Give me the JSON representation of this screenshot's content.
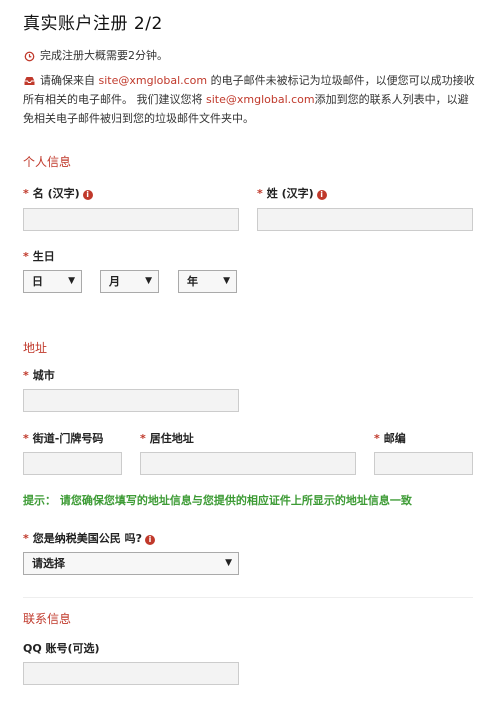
{
  "page": {
    "title": "真实账户注册 2/2"
  },
  "notices": {
    "time_text": "完成注册大概需要2分钟。",
    "email_part1": "请确保来自 ",
    "email_link1": "site@xmglobal.com",
    "email_part2": " 的电子邮件未被标记为垃圾邮件，以便您可以成功接收所有相关的电子邮件。 我们建议您将 ",
    "email_link2": "site@xmglobal.com",
    "email_part3": "添加到您的联系人列表中，以避免相关电子邮件被归到您的垃圾邮件文件夹中。"
  },
  "personal": {
    "section_title": "个人信息",
    "first_name_label": "名 (汉字)",
    "last_name_label": "姓 (汉字)",
    "dob_label": "生日",
    "day": "日",
    "month": "月",
    "year": "年"
  },
  "address": {
    "section_title": "地址",
    "city_label": "城市",
    "street_label": "街道-门牌号码",
    "residence_label": "居住地址",
    "postcode_label": "邮编",
    "hint": "提示：  请您确保您填写的地址信息与您提供的相应证件上所显示的地址信息一致"
  },
  "tax": {
    "us_citizen_label": "您是纳税美国公民 吗?",
    "us_citizen_value": "请选择"
  },
  "contact": {
    "section_title": "联系信息",
    "qq_label": "QQ 账号(可选)"
  },
  "common": {
    "required_mark": "*",
    "info_glyph": "i",
    "arrow_glyph": "▼"
  },
  "colors": {
    "accent": "#c0392b",
    "hint_green": "#3d9b35",
    "input_bg": "#f3f3f3"
  }
}
